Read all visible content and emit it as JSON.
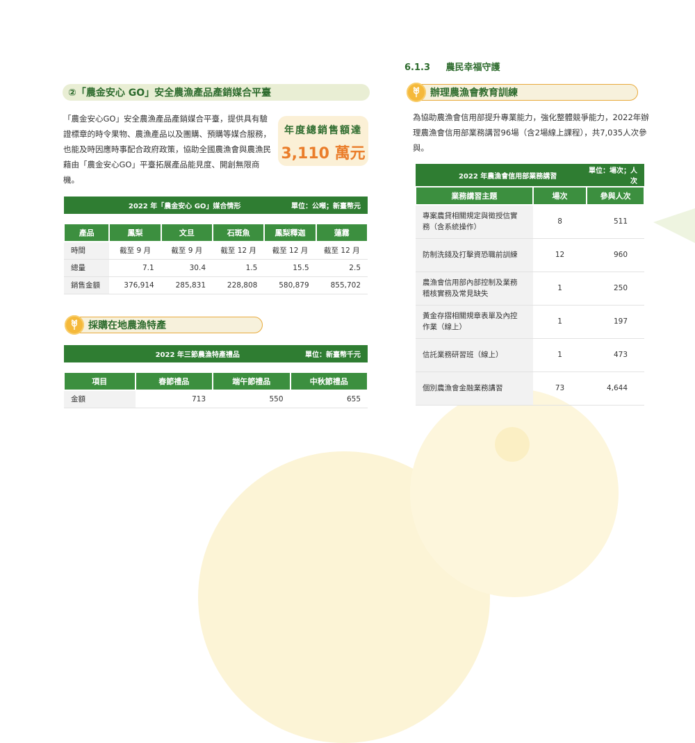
{
  "left": {
    "section1": {
      "title": "②「農金安心 GO」安全農漁產品產銷媒合平臺",
      "paragraph": "「農金安心GO」安全農漁產品產銷媒合平臺，提供具有驗證標章的時令果物、農漁產品以及團購、預購等媒合服務，也能及時因應時事配合政府政策，協助全國農漁會與農漁民藉由「農金安心GO」平臺拓展產品能見度、開創無限商機。",
      "callout_label": "年度總銷售額達",
      "callout_value": "3,110 萬元"
    },
    "table1": {
      "title": "2022 年「農金安心 GO」媒合情形",
      "unit": "單位：公噸；新臺幣元",
      "headers": [
        "產品",
        "鳳梨",
        "文旦",
        "石斑魚",
        "鳳梨釋迦",
        "蓮霧"
      ],
      "rows": [
        [
          "時間",
          "截至 9 月",
          "截至 9 月",
          "截至 12 月",
          "截至 12 月",
          "截至 12 月"
        ],
        [
          "總量",
          "7.1",
          "30.4",
          "1.5",
          "15.5",
          "2.5"
        ],
        [
          "銷售金額",
          "376,914",
          "285,831",
          "228,808",
          "580,879",
          "855,702"
        ]
      ]
    },
    "section2": {
      "title": "採購在地農漁特產"
    },
    "table2": {
      "title": "2022 年三節農漁特產禮品",
      "unit": "單位：新臺幣千元",
      "headers": [
        "項目",
        "春節禮品",
        "端午節禮品",
        "中秋節禮品"
      ],
      "rows": [
        [
          "金額",
          "713",
          "550",
          "655"
        ]
      ]
    }
  },
  "right": {
    "heading_no": "6.1.3",
    "heading_title": "農民幸福守護",
    "section": {
      "title": "辦理農漁會教育訓練",
      "paragraph": "為協助農漁會信用部提升專業能力，強化整體競爭能力，2022年辦理農漁會信用部業務講習96場（含2場線上課程），共7,035人次參與。"
    },
    "table": {
      "title": "2022 年農漁會信用部業務講習",
      "unit": "單位：場次；人次",
      "headers": [
        "業務講習主題",
        "場次",
        "參與人次"
      ],
      "rows": [
        [
          "專案農貸相關規定與徵授信實務（含系統操作）",
          "8",
          "511"
        ],
        [
          "防制洗錢及打擊資恐職前訓練",
          "12",
          "960"
        ],
        [
          "農漁會信用部內部控制及業務稽核實務及常見缺失",
          "1",
          "250"
        ],
        [
          "黃金存摺相關規章表單及內控作業（線上）",
          "1",
          "197"
        ],
        [
          "信託業務研習班（線上）",
          "1",
          "473"
        ],
        [
          "個別農漁會金融業務講習",
          "73",
          "4,644"
        ]
      ]
    }
  },
  "colors": {
    "green_dark": "#2f7d32",
    "green_head": "#3c8f3f",
    "accent_orange": "#ea7d2a",
    "pill_border": "#e8a93a",
    "badge_yellow": "#f5b93a"
  },
  "icons": [
    "wheat-icon"
  ]
}
